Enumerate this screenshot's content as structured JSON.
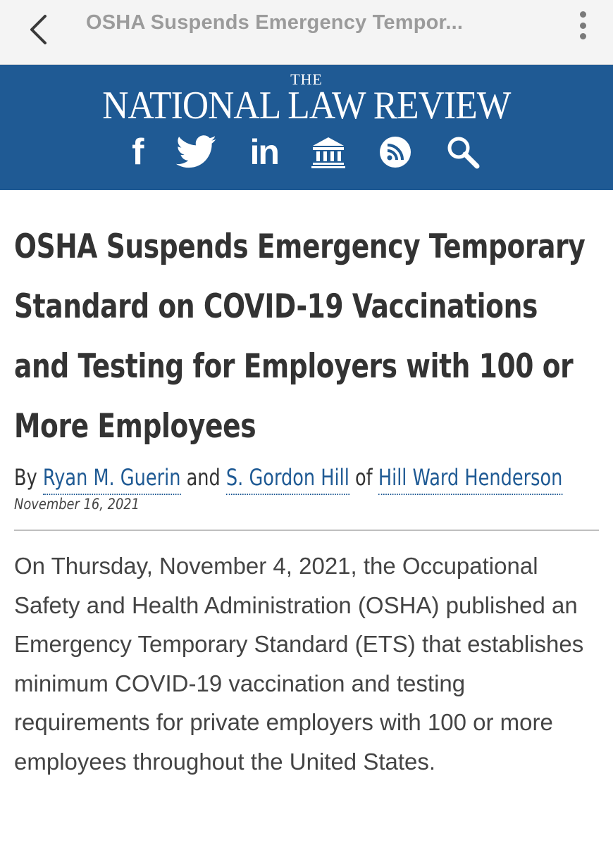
{
  "topbar": {
    "title": "OSHA Suspends Emergency Tempor...",
    "back_icon": "chevron-left-icon",
    "more_icon": "vertical-dots-icon"
  },
  "masthead": {
    "the": "THE",
    "name": "NATIONAL LAW REVIEW",
    "background_color": "#1f5a94",
    "icons": [
      "facebook-icon",
      "twitter-icon",
      "linkedin-icon",
      "institution-icon",
      "rss-icon",
      "search-icon"
    ],
    "facebook_glyph": "f",
    "linkedin_glyph": "in"
  },
  "article": {
    "title": "OSHA Suspends Emergency Temporary Standard on COVID-19 Vaccinations and Testing for Employers with 100 or More Employees",
    "by_label": "By",
    "author1": "Ryan M. Guerin",
    "and_label": "and",
    "author2": "S. Gordon Hill",
    "of_label": "of",
    "firm": "Hill Ward Henderson",
    "date": "November 16, 2021",
    "body": "On Thursday, November 4, 2021, the Occupational Safety and Health Administration (OSHA) published an Emergency Temporary Standard (ETS) that establishes minimum COVID-19 vaccination and testing requirements for private employers with 100 or more employees throughout the United States.",
    "link_color": "#1f5a94"
  }
}
